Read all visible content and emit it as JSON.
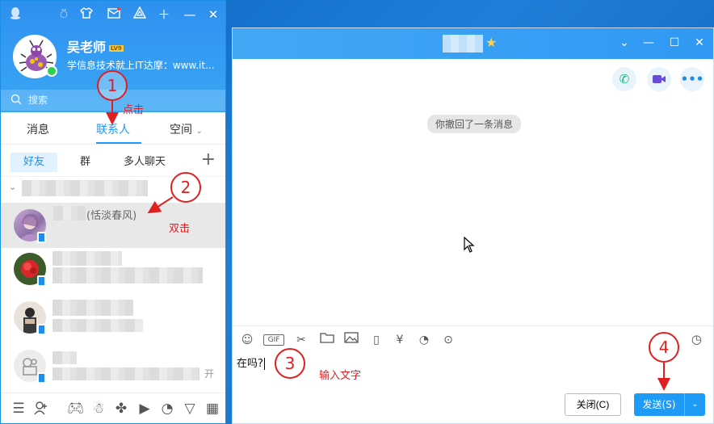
{
  "qq": {
    "nickname": "吴老师",
    "level_badge": "LV9",
    "signature": "学信息技术就上IT达摩：www.it...",
    "search_placeholder": "搜索",
    "tabs": [
      {
        "label": "消息"
      },
      {
        "label": "联系人"
      },
      {
        "label": "空间"
      }
    ],
    "subtabs": [
      {
        "label": "好友"
      },
      {
        "label": "群"
      },
      {
        "label": "多人聊天"
      }
    ],
    "contacts": [
      {
        "remark": "(恬淡春风)"
      },
      {
        "remark": ""
      },
      {
        "remark": ""
      },
      {
        "remark": "开"
      }
    ]
  },
  "chat": {
    "recall_notice": "你撤回了一条消息",
    "input_text": "在吗?",
    "close_button": "关闭(C)",
    "send_button": "发送(S)"
  },
  "annotations": {
    "step1": "1",
    "step1_note": "点击",
    "step2": "2",
    "step2_note": "双击",
    "step3": "3",
    "step3_note": "输入文字",
    "step4": "4"
  },
  "colors": {
    "accent": "#1e9af7",
    "annotation": "#e02020",
    "header": "#2e90f0"
  }
}
